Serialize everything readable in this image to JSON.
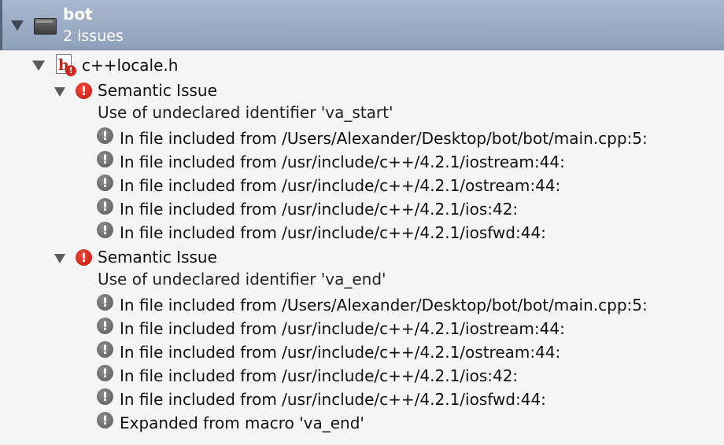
{
  "project": {
    "name": "bot",
    "issue_count": "2 issues",
    "icon": "project-folder-icon"
  },
  "file": {
    "name": "c++locale.h",
    "icon": "header-file-icon",
    "badge": "!"
  },
  "issues": [
    {
      "title": "Semantic Issue",
      "message": "Use of undeclared identifier 'va_start'",
      "notes": [
        "In file included from /Users/Alexander/Desktop/bot/bot/main.cpp:5:",
        "In file included from /usr/include/c++/4.2.1/iostream:44:",
        "In file included from /usr/include/c++/4.2.1/ostream:44:",
        "In file included from /usr/include/c++/4.2.1/ios:42:",
        "In file included from /usr/include/c++/4.2.1/iosfwd:44:"
      ]
    },
    {
      "title": "Semantic Issue",
      "message": "Use of undeclared identifier 'va_end'",
      "notes": [
        "In file included from /Users/Alexander/Desktop/bot/bot/main.cpp:5:",
        "In file included from /usr/include/c++/4.2.1/iostream:44:",
        "In file included from /usr/include/c++/4.2.1/ostream:44:",
        "In file included from /usr/include/c++/4.2.1/ios:42:",
        "In file included from /usr/include/c++/4.2.1/iosfwd:44:",
        "Expanded from macro 'va_end'"
      ]
    }
  ],
  "icons": {
    "error_glyph": "!",
    "note_glyph": "!"
  },
  "colors": {
    "error": "#d2271c",
    "note": "#6e6e6e",
    "header_bg": "#9fb0c8"
  }
}
